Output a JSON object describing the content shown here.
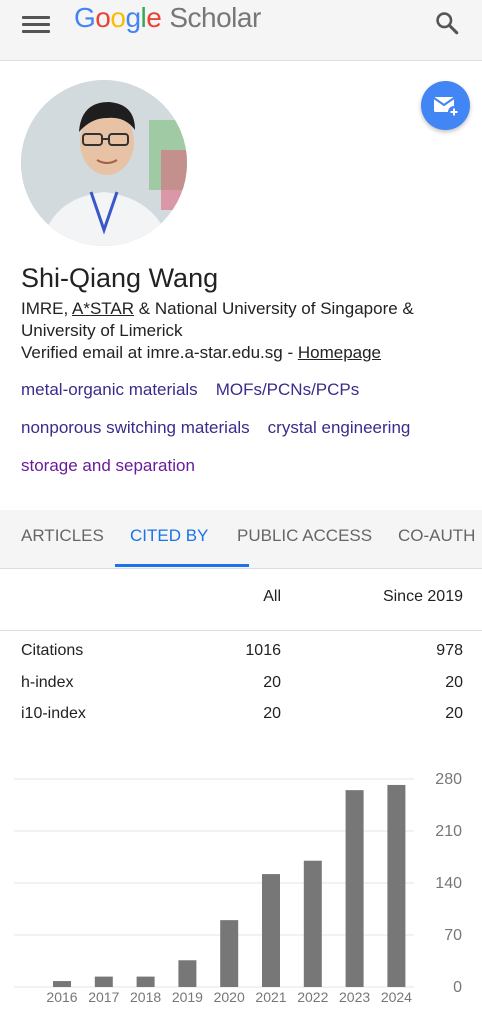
{
  "topbar": {
    "logo_letters": [
      "G",
      "o",
      "o",
      "g",
      "l",
      "e"
    ],
    "logo_suffix": "Scholar",
    "menu_icon": "hamburger-menu-icon",
    "search_icon": "search-icon"
  },
  "profile": {
    "name": "Shi-Qiang Wang",
    "affiliation_prefix": "IMRE, ",
    "affiliation_link": "A*STAR",
    "affiliation_suffix": " & National University of Singapore & University of Limerick",
    "email_text": "Verified email at imre.a-star.edu.sg - ",
    "homepage_label": "Homepage",
    "follow_icon": "email-follow-icon"
  },
  "interests": [
    [
      "metal-organic materials",
      "MOFs/PCNs/PCPs"
    ],
    [
      "nonporous switching materials",
      "crystal engineering"
    ],
    [
      "storage and separation"
    ]
  ],
  "tabs": [
    {
      "label": "ARTICLES",
      "active": false
    },
    {
      "label": "CITED BY",
      "active": true
    },
    {
      "label": "PUBLIC ACCESS",
      "active": false
    },
    {
      "label": "CO-AUTH",
      "active": false
    }
  ],
  "stats": {
    "col_all": "All",
    "col_since": "Since 2019",
    "rows": [
      {
        "label": "Citations",
        "all": "1016",
        "since": "978"
      },
      {
        "label": "h-index",
        "all": "20",
        "since": "20"
      },
      {
        "label": "i10-index",
        "all": "20",
        "since": "20"
      }
    ]
  },
  "colors": {
    "accent": "#1a73e8",
    "bar": "#777777",
    "follow_button": "#4285f4"
  },
  "chart_data": {
    "type": "bar",
    "categories": [
      "2016",
      "2017",
      "2018",
      "2019",
      "2020",
      "2021",
      "2022",
      "2023",
      "2024"
    ],
    "values": [
      8,
      14,
      14,
      36,
      90,
      152,
      170,
      265,
      272
    ],
    "yticks": [
      0,
      70,
      140,
      210,
      280
    ],
    "ylim": [
      0,
      280
    ],
    "grid": true,
    "title": "",
    "xlabel": "",
    "ylabel": ""
  }
}
